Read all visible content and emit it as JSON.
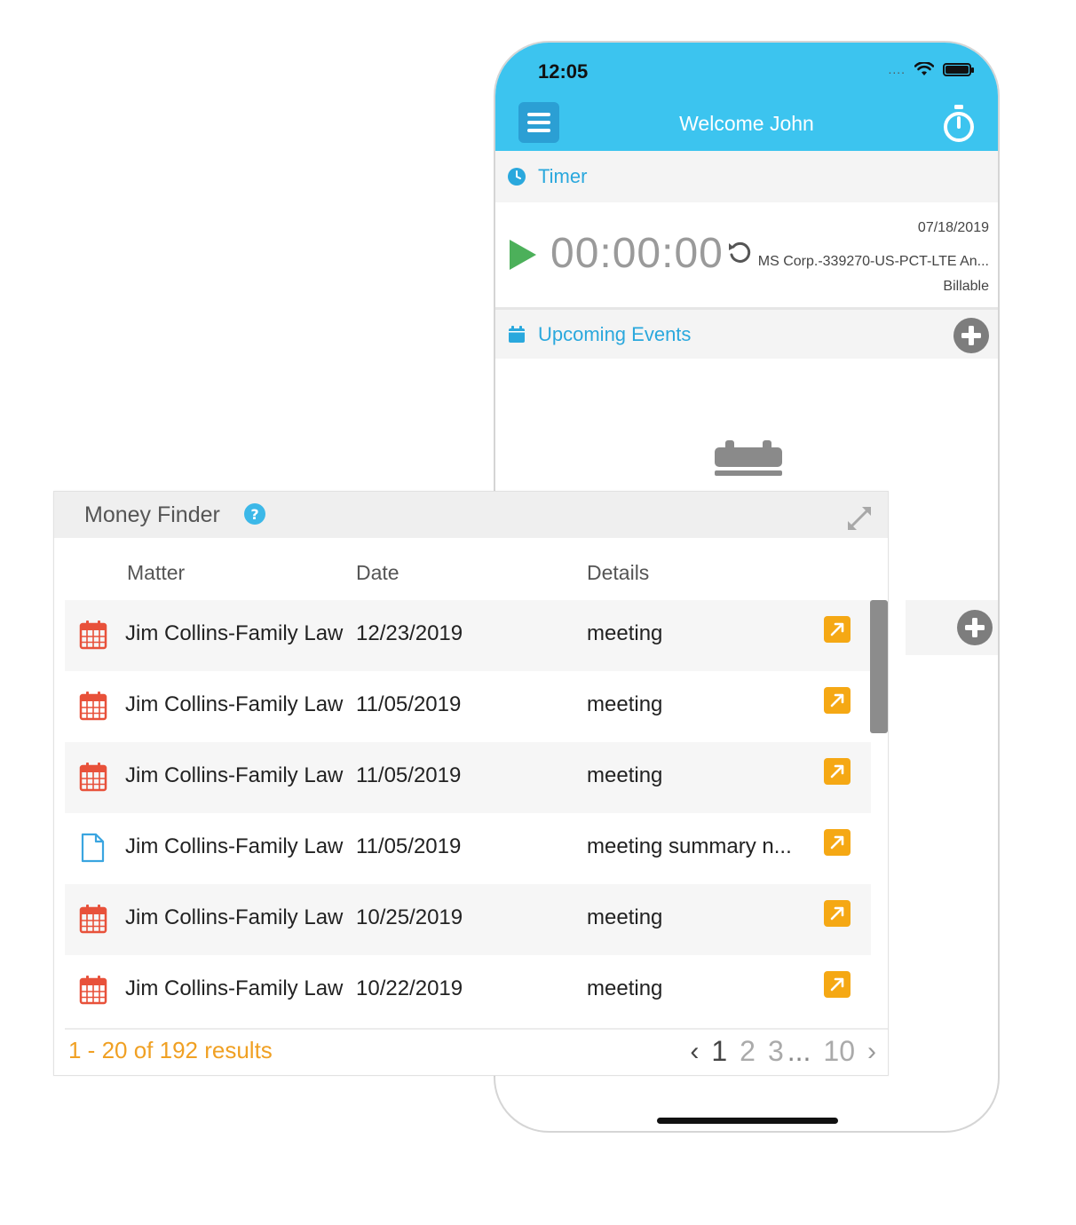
{
  "phone": {
    "status_time": "12:05",
    "signal": "....",
    "header_title": "Welcome John",
    "timer_section_label": "Timer",
    "timer_display": "00:00:00",
    "timer_date": "07/18/2019",
    "timer_matter": "MS Corp.-339270-US-PCT-LTE An...",
    "timer_billing": "Billable",
    "events_section_label": "Upcoming Events",
    "accent_color": "#3cc4ef"
  },
  "money_finder": {
    "title": "Money Finder",
    "columns": {
      "matter": "Matter",
      "date": "Date",
      "details": "Details"
    },
    "rows": [
      {
        "icon": "calendar-icon",
        "matter": "Jim Collins-Family Law",
        "date": "12/23/2019",
        "details": "meeting"
      },
      {
        "icon": "calendar-icon",
        "matter": "Jim Collins-Family Law",
        "date": "11/05/2019",
        "details": "meeting"
      },
      {
        "icon": "calendar-icon",
        "matter": "Jim Collins-Family Law",
        "date": "11/05/2019",
        "details": "meeting"
      },
      {
        "icon": "document-icon",
        "matter": "Jim Collins-Family Law",
        "date": "11/05/2019",
        "details": "meeting summary n..."
      },
      {
        "icon": "calendar-icon",
        "matter": "Jim Collins-Family Law",
        "date": "10/25/2019",
        "details": "meeting"
      },
      {
        "icon": "calendar-icon",
        "matter": "Jim Collins-Family Law",
        "date": "10/22/2019",
        "details": "meeting"
      }
    ],
    "results_text": "1 - 20 of 192 results",
    "pagination": {
      "prev": "‹",
      "pages": [
        "1",
        "2",
        "3"
      ],
      "ellipsis": "...",
      "last": "10",
      "next": "›"
    },
    "accent_color": "#f5a814"
  }
}
